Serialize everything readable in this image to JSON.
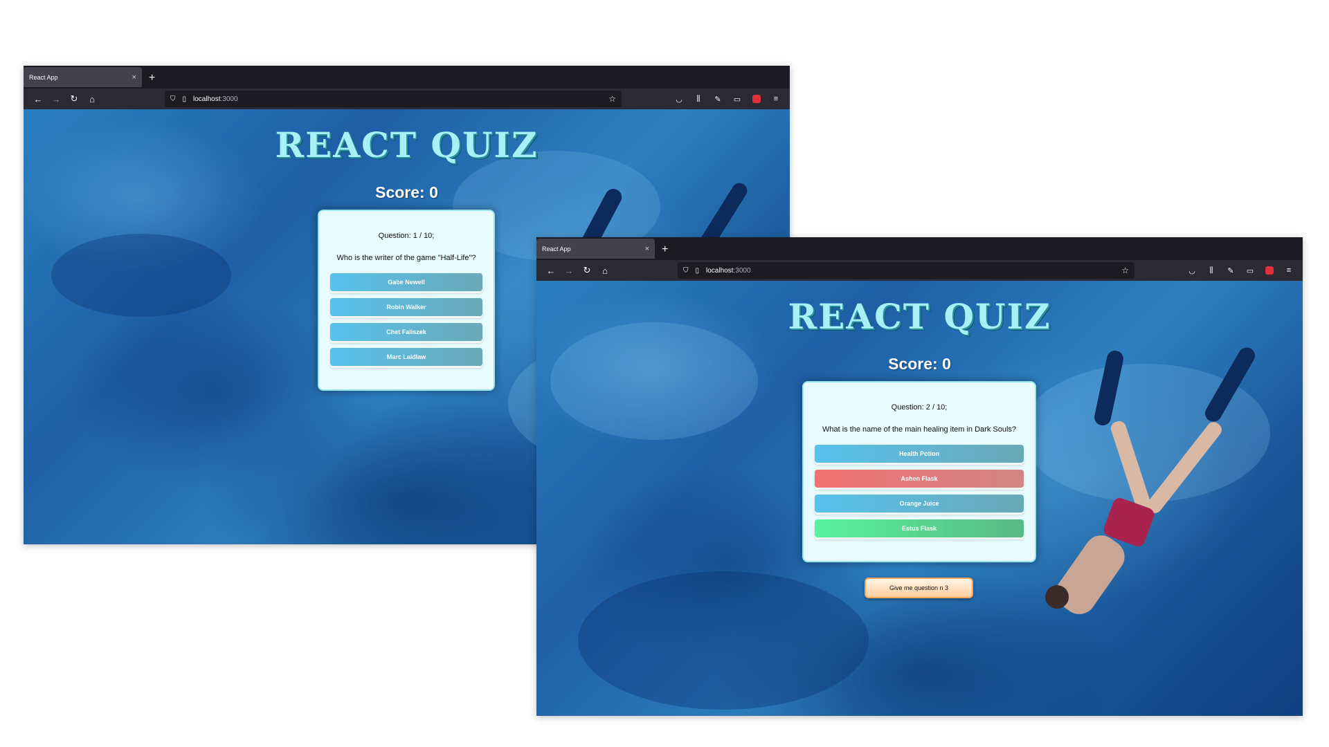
{
  "windows": [
    {
      "tab_title": "React App",
      "url_host": "localhost",
      "url_port": ":3000",
      "app_title": "REACT QUIZ",
      "score_label": "Score: 0",
      "question_number": "Question: 1 / 10;",
      "question_text": "Who is the writer of the game \"Half-Life\"?",
      "answers": [
        "Gabe Newell",
        "Robin Walker",
        "Chet Faliszek",
        "Marc Laidlaw"
      ],
      "answer_states": [
        "neutral",
        "neutral",
        "neutral",
        "neutral"
      ]
    },
    {
      "tab_title": "React App",
      "url_host": "localhost",
      "url_port": ":3000",
      "app_title": "REACT QUIZ",
      "score_label": "Score: 0",
      "question_number": "Question: 2 / 10;",
      "question_text": "What is the name of the main healing item in Dark Souls?",
      "answers": [
        "Health Potion",
        "Ashen Flask",
        "Orange Juice",
        "Estus Flask"
      ],
      "answer_states": [
        "neutral",
        "wrong",
        "neutral",
        "correct"
      ],
      "next_button": "Give me question n 3"
    }
  ],
  "icons": {
    "close": "×",
    "new_tab": "+",
    "back": "←",
    "forward": "→",
    "reload": "↻",
    "home": "⌂",
    "shield": "⛉",
    "page": "▯",
    "star": "☆",
    "pocket": "◡",
    "library": "⫼",
    "wrench": "✎",
    "sidebar": "▭",
    "menu": "≡"
  },
  "colors": {
    "answer_neutral": "#56c2ee",
    "answer_wrong": "#f27272",
    "answer_correct": "#57f39d",
    "title": "#a7f0f5"
  }
}
